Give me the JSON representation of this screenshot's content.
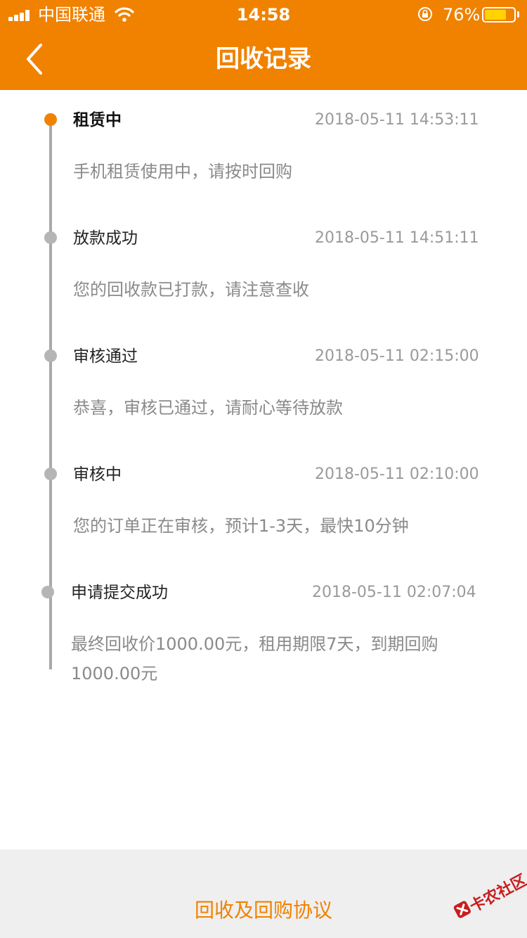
{
  "status_bar": {
    "carrier": "中国联通",
    "time": "14:58",
    "battery_percent_text": "76%",
    "battery_level": 0.76
  },
  "nav": {
    "title": "回收记录",
    "back_icon": "chevron-left-icon"
  },
  "timeline": [
    {
      "title": "租赁中",
      "time": "2018-05-11 14:53:11",
      "desc": "手机租赁使用中，请按时回购",
      "active": true
    },
    {
      "title": "放款成功",
      "time": "2018-05-11 14:51:11",
      "desc": "您的回收款已打款，请注意查收",
      "active": false
    },
    {
      "title": "审核通过",
      "time": "2018-05-11 02:15:00",
      "desc": "恭喜，审核已通过，请耐心等待放款",
      "active": false
    },
    {
      "title": "审核中",
      "time": "2018-05-11 02:10:00",
      "desc": "您的订单正在审核，预计1-3天，最快10分钟",
      "active": false
    },
    {
      "title": "申请提交成功",
      "time": "2018-05-11 02:07:04",
      "desc": "最终回收价1000.00元，租用期限7天，到期回购1000.00元",
      "active": false
    }
  ],
  "bottom": {
    "agreement_link": "回收及回购协议",
    "watermark_text": "卡农社区"
  },
  "colors": {
    "accent": "#f08200",
    "timeline_line": "#a9a9a9",
    "inactive_dot": "#b5b5b5",
    "muted_text": "#8a8a8a"
  }
}
